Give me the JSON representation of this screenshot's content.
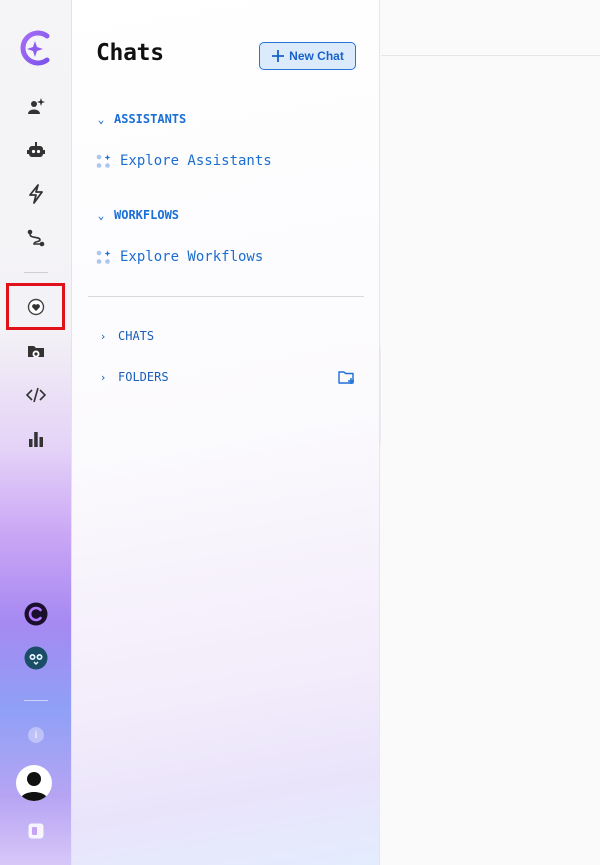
{
  "rail": {
    "items": [
      {
        "name": "logo-icon"
      },
      {
        "name": "assistant-add-icon"
      },
      {
        "name": "robot-icon"
      },
      {
        "name": "lightning-icon"
      },
      {
        "name": "workflow-icon"
      },
      {
        "name": "heart-icon"
      },
      {
        "name": "folder-share-icon"
      },
      {
        "name": "code-icon"
      },
      {
        "name": "bar-chart-icon"
      },
      {
        "name": "app-c-icon"
      },
      {
        "name": "app-owl-icon"
      },
      {
        "name": "info-icon"
      },
      {
        "name": "avatar"
      },
      {
        "name": "docs-icon"
      }
    ],
    "info_glyph": "i"
  },
  "panel": {
    "title": "Chats",
    "new_chat_label": "New Chat",
    "assistants_label": "ASSISTANTS",
    "explore_assistants": "Explore Assistants",
    "workflows_label": "WORKFLOWS",
    "explore_workflows": "Explore Workflows",
    "chats_label": "CHATS",
    "folders_label": "FOLDERS"
  },
  "colors": {
    "accent": "#1a6fd4",
    "highlight": "#e0111b",
    "brand": "#8e5cf0"
  }
}
